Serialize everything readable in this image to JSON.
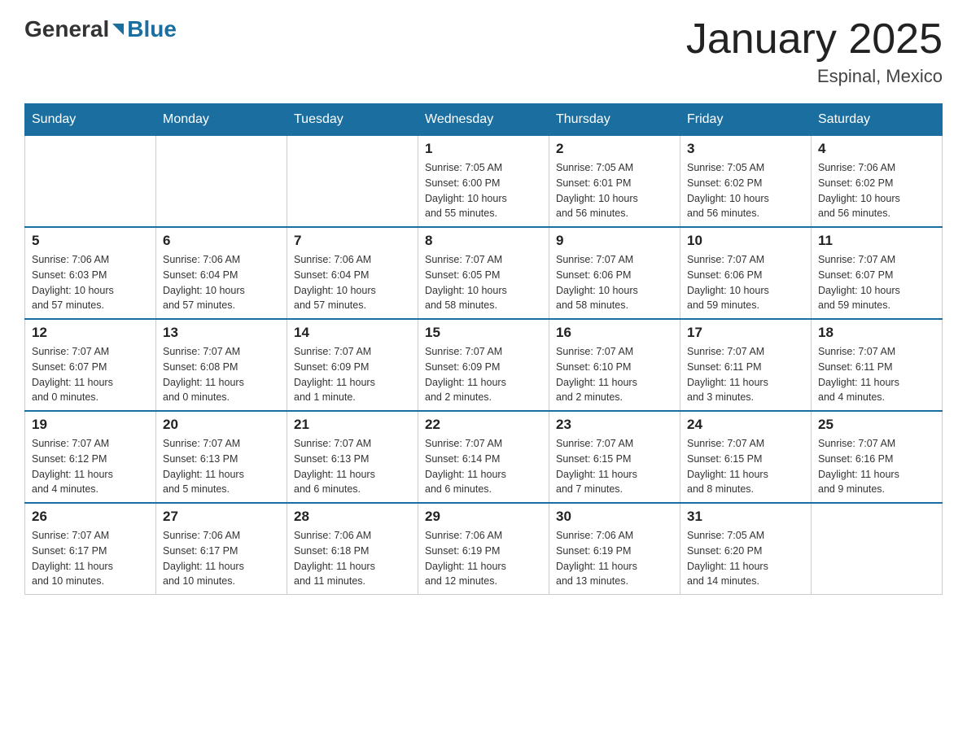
{
  "header": {
    "logo_general": "General",
    "logo_blue": "Blue",
    "title": "January 2025",
    "location": "Espinal, Mexico"
  },
  "days_of_week": [
    "Sunday",
    "Monday",
    "Tuesday",
    "Wednesday",
    "Thursday",
    "Friday",
    "Saturday"
  ],
  "weeks": [
    [
      {
        "day": "",
        "info": ""
      },
      {
        "day": "",
        "info": ""
      },
      {
        "day": "",
        "info": ""
      },
      {
        "day": "1",
        "info": "Sunrise: 7:05 AM\nSunset: 6:00 PM\nDaylight: 10 hours\nand 55 minutes."
      },
      {
        "day": "2",
        "info": "Sunrise: 7:05 AM\nSunset: 6:01 PM\nDaylight: 10 hours\nand 56 minutes."
      },
      {
        "day": "3",
        "info": "Sunrise: 7:05 AM\nSunset: 6:02 PM\nDaylight: 10 hours\nand 56 minutes."
      },
      {
        "day": "4",
        "info": "Sunrise: 7:06 AM\nSunset: 6:02 PM\nDaylight: 10 hours\nand 56 minutes."
      }
    ],
    [
      {
        "day": "5",
        "info": "Sunrise: 7:06 AM\nSunset: 6:03 PM\nDaylight: 10 hours\nand 57 minutes."
      },
      {
        "day": "6",
        "info": "Sunrise: 7:06 AM\nSunset: 6:04 PM\nDaylight: 10 hours\nand 57 minutes."
      },
      {
        "day": "7",
        "info": "Sunrise: 7:06 AM\nSunset: 6:04 PM\nDaylight: 10 hours\nand 57 minutes."
      },
      {
        "day": "8",
        "info": "Sunrise: 7:07 AM\nSunset: 6:05 PM\nDaylight: 10 hours\nand 58 minutes."
      },
      {
        "day": "9",
        "info": "Sunrise: 7:07 AM\nSunset: 6:06 PM\nDaylight: 10 hours\nand 58 minutes."
      },
      {
        "day": "10",
        "info": "Sunrise: 7:07 AM\nSunset: 6:06 PM\nDaylight: 10 hours\nand 59 minutes."
      },
      {
        "day": "11",
        "info": "Sunrise: 7:07 AM\nSunset: 6:07 PM\nDaylight: 10 hours\nand 59 minutes."
      }
    ],
    [
      {
        "day": "12",
        "info": "Sunrise: 7:07 AM\nSunset: 6:07 PM\nDaylight: 11 hours\nand 0 minutes."
      },
      {
        "day": "13",
        "info": "Sunrise: 7:07 AM\nSunset: 6:08 PM\nDaylight: 11 hours\nand 0 minutes."
      },
      {
        "day": "14",
        "info": "Sunrise: 7:07 AM\nSunset: 6:09 PM\nDaylight: 11 hours\nand 1 minute."
      },
      {
        "day": "15",
        "info": "Sunrise: 7:07 AM\nSunset: 6:09 PM\nDaylight: 11 hours\nand 2 minutes."
      },
      {
        "day": "16",
        "info": "Sunrise: 7:07 AM\nSunset: 6:10 PM\nDaylight: 11 hours\nand 2 minutes."
      },
      {
        "day": "17",
        "info": "Sunrise: 7:07 AM\nSunset: 6:11 PM\nDaylight: 11 hours\nand 3 minutes."
      },
      {
        "day": "18",
        "info": "Sunrise: 7:07 AM\nSunset: 6:11 PM\nDaylight: 11 hours\nand 4 minutes."
      }
    ],
    [
      {
        "day": "19",
        "info": "Sunrise: 7:07 AM\nSunset: 6:12 PM\nDaylight: 11 hours\nand 4 minutes."
      },
      {
        "day": "20",
        "info": "Sunrise: 7:07 AM\nSunset: 6:13 PM\nDaylight: 11 hours\nand 5 minutes."
      },
      {
        "day": "21",
        "info": "Sunrise: 7:07 AM\nSunset: 6:13 PM\nDaylight: 11 hours\nand 6 minutes."
      },
      {
        "day": "22",
        "info": "Sunrise: 7:07 AM\nSunset: 6:14 PM\nDaylight: 11 hours\nand 6 minutes."
      },
      {
        "day": "23",
        "info": "Sunrise: 7:07 AM\nSunset: 6:15 PM\nDaylight: 11 hours\nand 7 minutes."
      },
      {
        "day": "24",
        "info": "Sunrise: 7:07 AM\nSunset: 6:15 PM\nDaylight: 11 hours\nand 8 minutes."
      },
      {
        "day": "25",
        "info": "Sunrise: 7:07 AM\nSunset: 6:16 PM\nDaylight: 11 hours\nand 9 minutes."
      }
    ],
    [
      {
        "day": "26",
        "info": "Sunrise: 7:07 AM\nSunset: 6:17 PM\nDaylight: 11 hours\nand 10 minutes."
      },
      {
        "day": "27",
        "info": "Sunrise: 7:06 AM\nSunset: 6:17 PM\nDaylight: 11 hours\nand 10 minutes."
      },
      {
        "day": "28",
        "info": "Sunrise: 7:06 AM\nSunset: 6:18 PM\nDaylight: 11 hours\nand 11 minutes."
      },
      {
        "day": "29",
        "info": "Sunrise: 7:06 AM\nSunset: 6:19 PM\nDaylight: 11 hours\nand 12 minutes."
      },
      {
        "day": "30",
        "info": "Sunrise: 7:06 AM\nSunset: 6:19 PM\nDaylight: 11 hours\nand 13 minutes."
      },
      {
        "day": "31",
        "info": "Sunrise: 7:05 AM\nSunset: 6:20 PM\nDaylight: 11 hours\nand 14 minutes."
      },
      {
        "day": "",
        "info": ""
      }
    ]
  ]
}
